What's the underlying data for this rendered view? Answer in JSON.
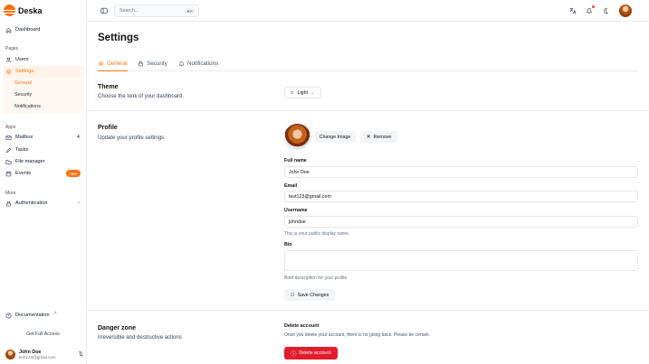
{
  "brand": {
    "name": "Deska"
  },
  "sidebar": {
    "dashboard": "Dashboard",
    "pages_title": "Pages",
    "users": "Users",
    "settings": "Settings",
    "sub": [
      "General",
      "Security",
      "Notifications"
    ],
    "apps_title": "Apps",
    "mailbox": "Mailbox",
    "mailbox_count": "4",
    "tasks": "Tasks",
    "file_manager": "File manager",
    "events": "Events",
    "events_badge": "new",
    "more_title": "More",
    "authentication": "Authentication",
    "documentation": "Documentation",
    "get_access": "Get Full Access",
    "user_name": "John Doe",
    "user_email": "test123@gmail.com"
  },
  "topbar": {
    "search_placeholder": "Search...",
    "search_shortcut": "⌘K"
  },
  "page": {
    "title": "Settings"
  },
  "tabs": [
    "General",
    "Security",
    "Notifications"
  ],
  "theme": {
    "title": "Theme",
    "desc": "Choose the look of your dashboard.",
    "value": "Light"
  },
  "profile": {
    "title": "Profile",
    "desc": "Update your profile settings.",
    "change_image": "Change Image",
    "remove": "Remove",
    "full_name_label": "Full name",
    "full_name": "John Doe",
    "email_label": "Email",
    "email": "test123@gmail.com",
    "username_label": "Username",
    "username": "johndoe",
    "username_hint": "This is your public display name.",
    "bio_label": "Bio",
    "bio": "",
    "bio_hint": "Brief description for your profile.",
    "save": "Save Changes"
  },
  "danger": {
    "title": "Danger zone",
    "desc": "Irreversible and destructive actions",
    "delete_title": "Delete account",
    "delete_desc": "Once you delete your account, there is no going back. Please be certain.",
    "delete_button": "Delete account"
  },
  "colors": {
    "accent": "#f97316",
    "danger": "#e11d2e"
  }
}
